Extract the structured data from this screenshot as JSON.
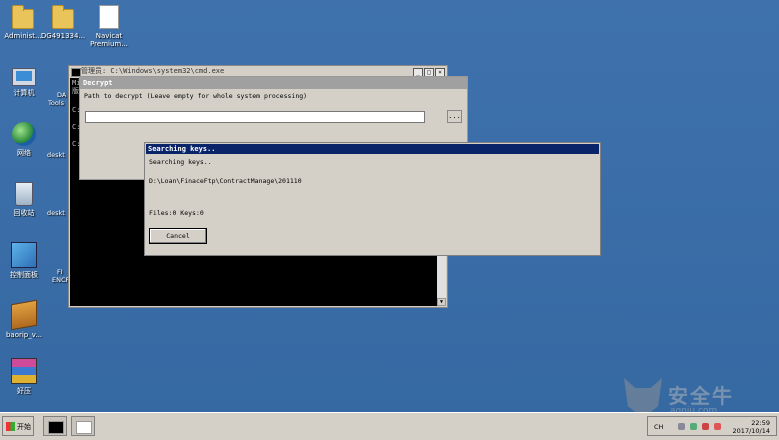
{
  "desktop_icons": [
    {
      "label": "Administ..."
    },
    {
      "label": "DG491334..."
    },
    {
      "label": "Navicat Premium..."
    },
    {
      "label": "计算机"
    },
    {
      "label": "网络"
    },
    {
      "label": "回收站"
    },
    {
      "label": "控制面板"
    },
    {
      "label": "baorip_v..."
    },
    {
      "label": "好压"
    }
  ],
  "left_stubs": [
    "DA",
    "Tools",
    "deskt",
    "deskt",
    "FI",
    "ENCR"
  ],
  "cmd_window": {
    "title": "管理员: C:\\Windows\\system32\\cmd.exe",
    "lines": [
      "Mi",
      "版",
      "C:",
      "C:",
      "C:"
    ]
  },
  "decrypt_window": {
    "title": "Decrypt",
    "prompt": "Path to decrypt (Leave empty for whole system processing)",
    "path_value": "",
    "browse_label": "..."
  },
  "search_dialog": {
    "title": "Searching keys..",
    "status": "Searching keys..",
    "current_path": "D:\\Loan\\FinaceFtp\\ContractManage\\201110",
    "counts": "Files:0 Keys:0",
    "cancel_label": "Cancel"
  },
  "taskbar": {
    "start_label": "开始",
    "tray_lang": "CH",
    "time": "22:59",
    "date": "2017/10/14"
  },
  "watermark": {
    "text": "安全牛",
    "sub": "aqniu.com"
  }
}
